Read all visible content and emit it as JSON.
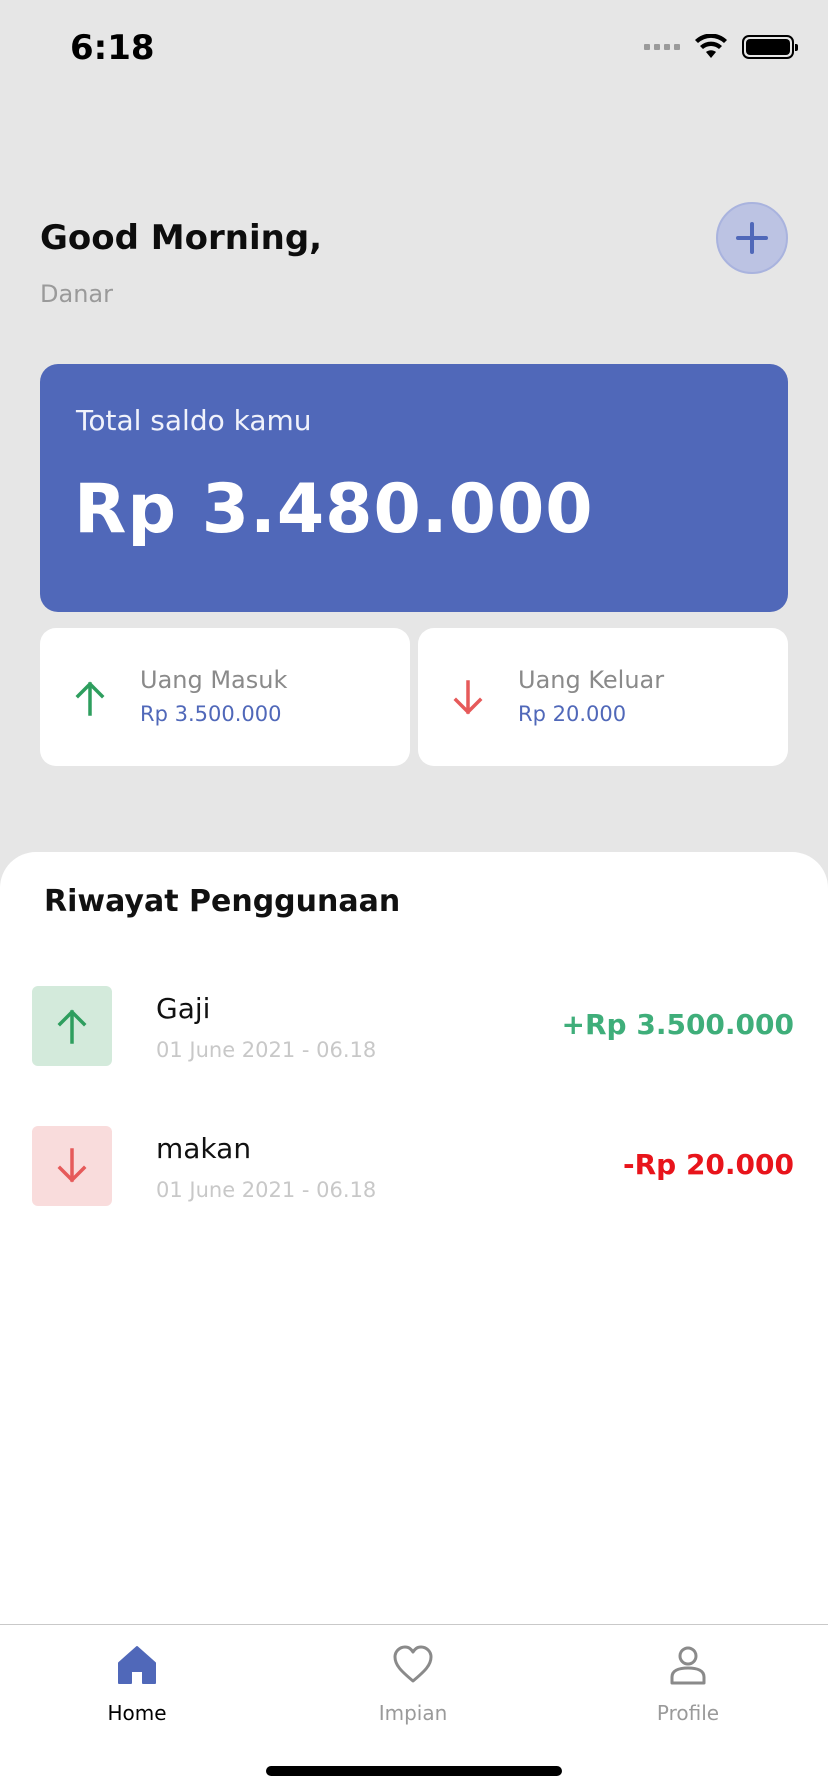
{
  "status_bar": {
    "time": "6:18",
    "icons": [
      "cellular-signal-icon",
      "wifi-icon",
      "battery-icon"
    ]
  },
  "header": {
    "greeting": "Good Morning,",
    "username": "Danar",
    "add_icon": "plus-icon"
  },
  "balance": {
    "label": "Total saldo kamu",
    "value": "Rp 3.480.000",
    "color": "#5068b9"
  },
  "summary": {
    "income": {
      "title": "Uang Masuk",
      "value": "Rp 3.500.000",
      "icon": "arrow-up-icon",
      "color": "#2e9e5e"
    },
    "expense": {
      "title": "Uang Keluar",
      "value": "Rp 20.000",
      "icon": "arrow-down-icon",
      "color": "#e65a5a"
    }
  },
  "history": {
    "title": "Riwayat Penggunaan",
    "items": [
      {
        "name": "Gaji",
        "date": "01 June 2021 - 06.18",
        "amount": "+Rp 3.500.000",
        "type": "in",
        "icon": "arrow-up-icon"
      },
      {
        "name": "makan",
        "date": "01 June 2021 - 06.18",
        "amount": "-Rp 20.000",
        "type": "out",
        "icon": "arrow-down-icon"
      }
    ]
  },
  "tabs": [
    {
      "label": "Home",
      "icon": "home-icon",
      "active": true
    },
    {
      "label": "Impian",
      "icon": "heart-icon",
      "active": false
    },
    {
      "label": "Profile",
      "icon": "user-icon",
      "active": false
    }
  ],
  "colors": {
    "accent": "#5068b9",
    "income": "#3fae7a",
    "expense": "#e8141b",
    "background": "#e6e6e6"
  }
}
